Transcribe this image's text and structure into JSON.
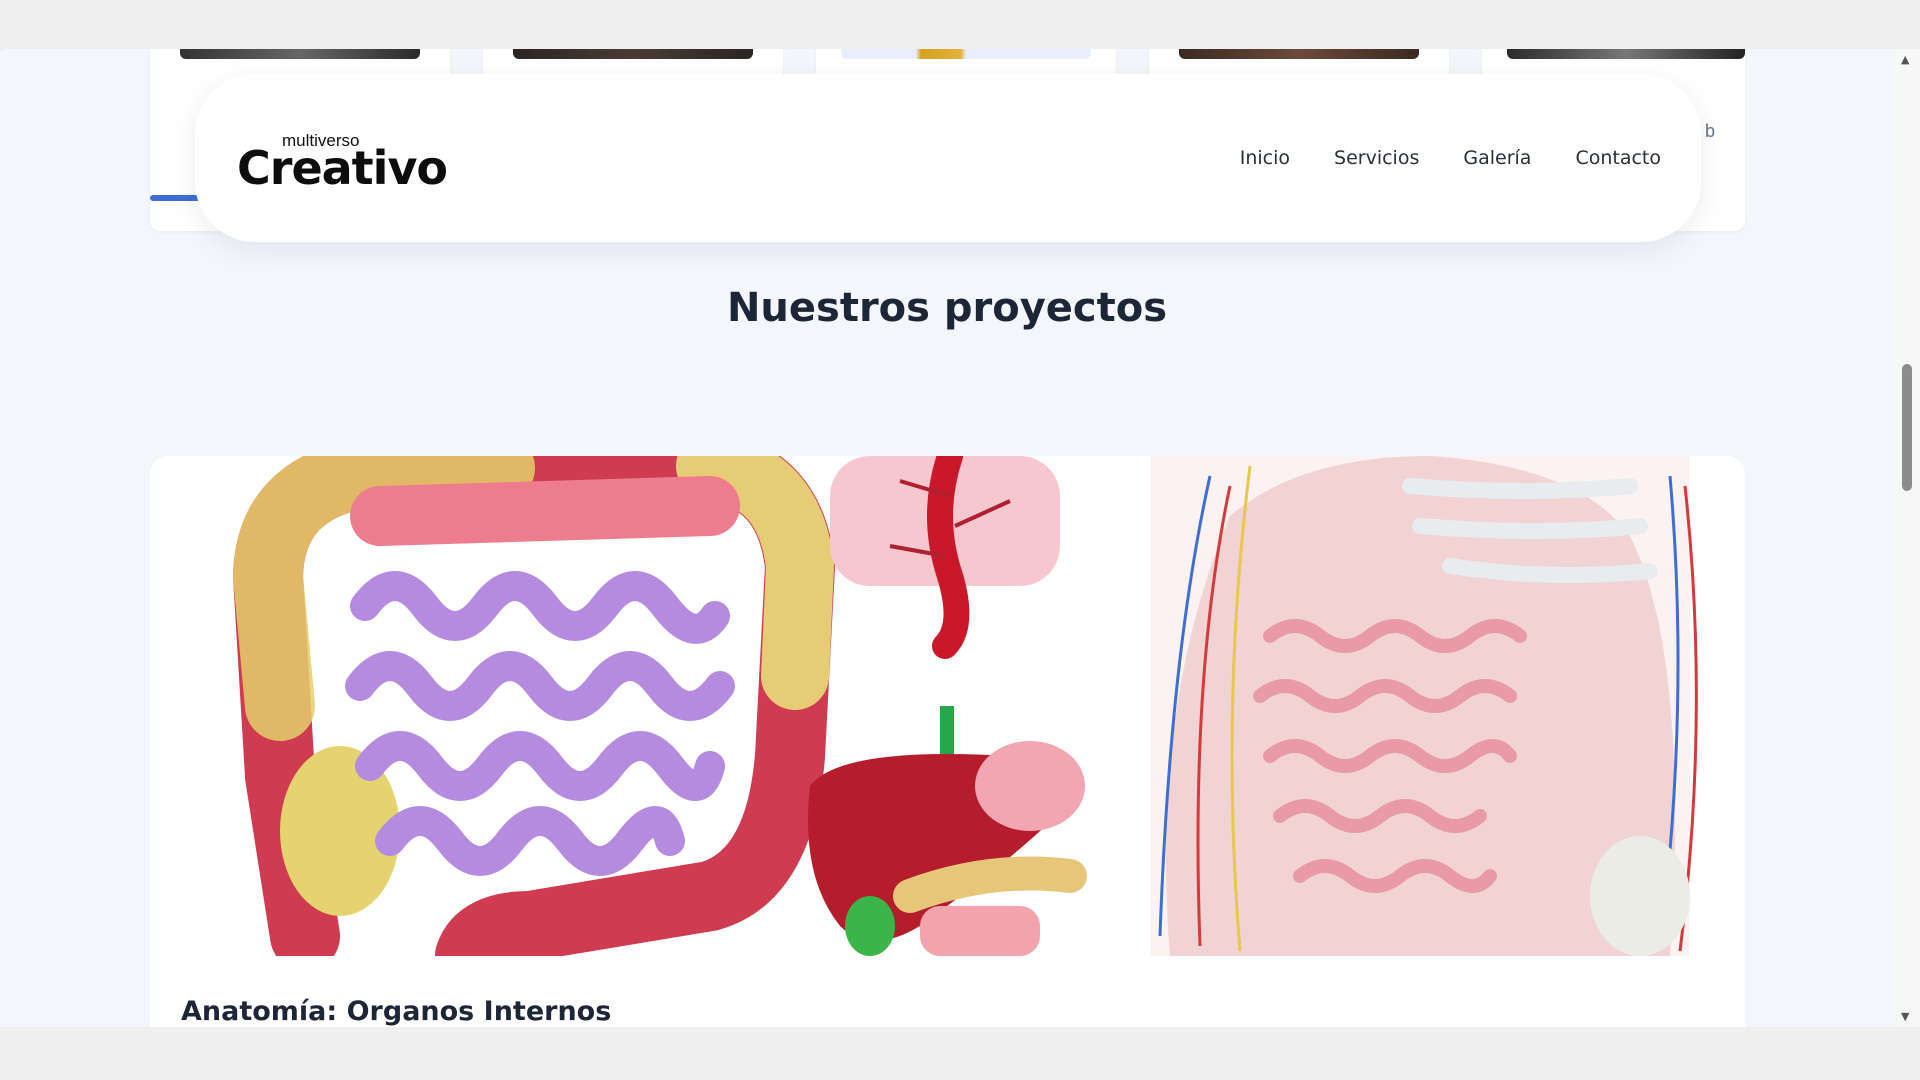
{
  "header": {
    "logo_small": "multiverso",
    "logo_big": "Creativo",
    "nav": [
      "Inicio",
      "Servicios",
      "Galería",
      "Contacto"
    ]
  },
  "top_cards": {
    "peek_text": "b"
  },
  "main": {
    "section_title": "Nuestros proyectos",
    "project": {
      "title": "Anatomía: Organos Internos"
    }
  },
  "colors": {
    "accent": "#3b6fd6",
    "page_bg": "#f3f6fa",
    "text_dark": "#1d2636"
  },
  "icons": {
    "scroll_up": "scroll-up-arrow-icon",
    "scroll_down": "scroll-down-arrow-icon"
  }
}
